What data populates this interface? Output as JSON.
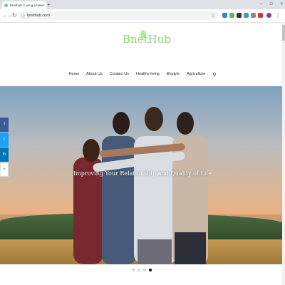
{
  "browser": {
    "tab_title": "Bnethub | Living a Healthy Life",
    "new_tab": "+",
    "tab_close": "×",
    "window_controls": [
      "–",
      "□",
      "×"
    ],
    "url": "bnethub.com"
  },
  "site": {
    "logo": "BnetHub",
    "menu": [
      "Home",
      "About Us",
      "Contact Us",
      "Healthy living",
      "lifestyle",
      "Agriculture"
    ],
    "hero_text": "Improving Your Relationship and Quality of Life"
  },
  "share": [
    {
      "icon": "facebook-icon",
      "glyph": "f",
      "color": "#3b5998"
    },
    {
      "icon": "twitter-icon",
      "glyph": "t",
      "color": "#1da1f2"
    },
    {
      "icon": "linkedin-icon",
      "glyph": "in",
      "color": "#0077b5"
    },
    {
      "icon": "more-icon",
      "glyph": "+",
      "color": "#ffffff"
    }
  ],
  "slider": {
    "count": 4,
    "active_index": 3
  }
}
